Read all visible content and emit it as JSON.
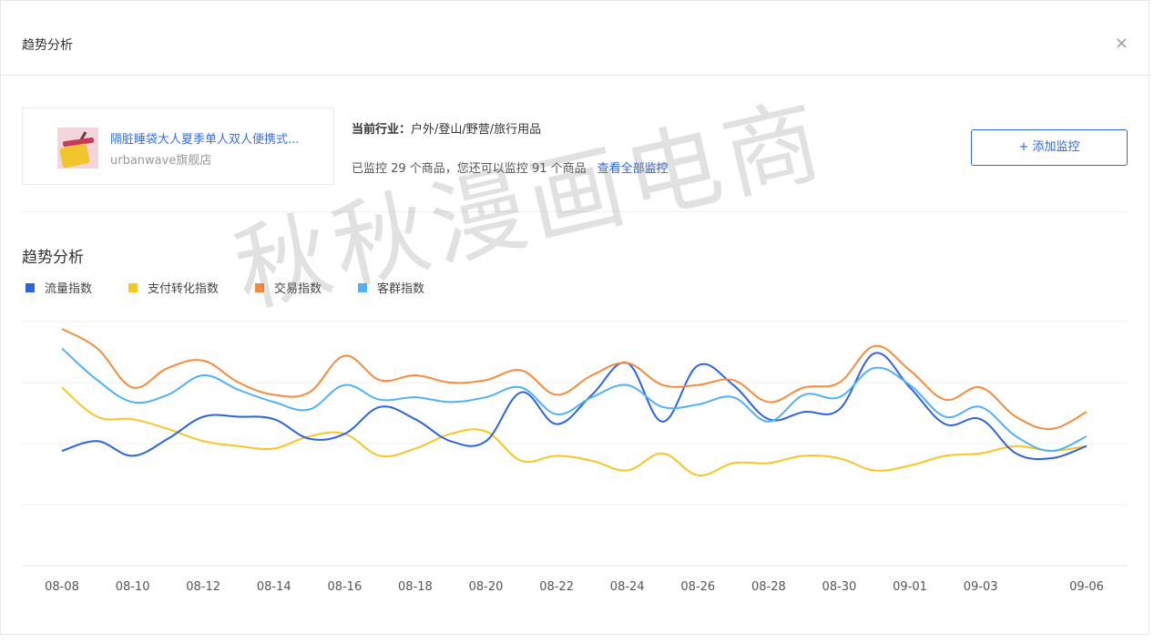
{
  "dialog": {
    "title": "趋势分析",
    "close_label": "×"
  },
  "product": {
    "name": "隔脏睡袋大人夏季单人双人便携式...",
    "shop": "urbanwave旗舰店"
  },
  "industry": {
    "label": "当前行业：",
    "value": "户外/登山/野营/旅行用品"
  },
  "monitor": {
    "text": "已监控 29 个商品，您还可以监控 91 个商品",
    "view_all": "查看全部监控"
  },
  "add_button_label": "+ 添加监控",
  "section_title": "趋势分析",
  "watermark": "秋秋漫画电商",
  "colors": {
    "accent": "#2e67d9",
    "flow": "#2d63e0",
    "pay": "#f5c626",
    "trade": "#f58b3c",
    "customer": "#52b0f7"
  },
  "chart_data": {
    "type": "line",
    "title": "",
    "xlabel": "",
    "ylabel": "",
    "ylim": [
      0,
      100
    ],
    "grid": true,
    "legend_position": "top-left",
    "x_tick_labels": [
      "08-08",
      "08-10",
      "08-12",
      "08-14",
      "08-16",
      "08-18",
      "08-20",
      "08-22",
      "08-24",
      "08-26",
      "08-28",
      "08-30",
      "09-01",
      "09-03",
      "09-06"
    ],
    "x": [
      "08-08",
      "08-09",
      "08-10",
      "08-11",
      "08-12",
      "08-13",
      "08-14",
      "08-15",
      "08-16",
      "08-17",
      "08-18",
      "08-19",
      "08-20",
      "08-21",
      "08-22",
      "08-23",
      "08-24",
      "08-25",
      "08-26",
      "08-27",
      "08-28",
      "08-29",
      "08-30",
      "08-31",
      "09-01",
      "09-02",
      "09-03",
      "09-04",
      "09-05",
      "09-06"
    ],
    "series": [
      {
        "name": "流量指数",
        "color": "#2d63e0",
        "values": [
          47,
          51,
          45,
          52,
          61,
          61,
          60,
          52,
          54,
          65,
          60,
          51,
          51,
          71,
          58,
          70,
          83,
          59,
          82,
          74,
          60,
          63,
          64,
          87,
          73,
          58,
          60,
          46,
          44,
          49
        ]
      },
      {
        "name": "支付转化指数",
        "color": "#f5c626",
        "values": [
          73,
          61,
          60,
          56,
          51,
          49,
          48,
          53,
          54,
          45,
          48,
          54,
          55,
          43,
          45,
          43,
          39,
          46,
          37,
          42,
          42,
          45,
          44,
          39,
          41,
          45,
          46,
          49,
          47,
          49
        ]
      },
      {
        "name": "交易指数",
        "color": "#f58b3c",
        "values": [
          97,
          89,
          73,
          81,
          84,
          75,
          70,
          71,
          86,
          76,
          78,
          75,
          76,
          80,
          70,
          78,
          83,
          74,
          74,
          76,
          67,
          73,
          75,
          90,
          80,
          68,
          73,
          61,
          56,
          63
        ]
      },
      {
        "name": "客群指数",
        "color": "#52b0f7",
        "values": [
          89,
          76,
          67,
          70,
          78,
          72,
          67,
          64,
          74,
          68,
          69,
          67,
          69,
          73,
          62,
          69,
          74,
          65,
          66,
          69,
          59,
          70,
          69,
          81,
          74,
          61,
          65,
          53,
          47,
          53
        ]
      }
    ]
  }
}
